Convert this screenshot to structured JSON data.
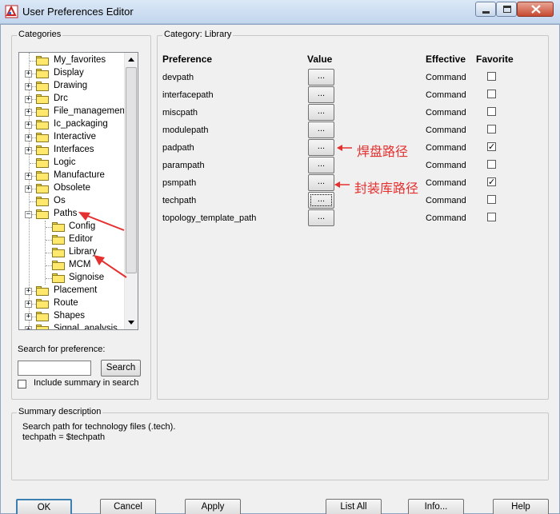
{
  "window": {
    "title": "User Preferences Editor"
  },
  "categories": {
    "label": "Categories",
    "items": [
      {
        "label": "My_favorites",
        "expander": ""
      },
      {
        "label": "Display",
        "expander": "+"
      },
      {
        "label": "Drawing",
        "expander": "+"
      },
      {
        "label": "Drc",
        "expander": "+"
      },
      {
        "label": "File_management",
        "expander": "+"
      },
      {
        "label": "Ic_packaging",
        "expander": "+"
      },
      {
        "label": "Interactive",
        "expander": "+"
      },
      {
        "label": "Interfaces",
        "expander": "+"
      },
      {
        "label": "Logic",
        "expander": ""
      },
      {
        "label": "Manufacture",
        "expander": "+"
      },
      {
        "label": "Obsolete",
        "expander": "+"
      },
      {
        "label": "Os",
        "expander": ""
      },
      {
        "label": "Paths",
        "expander": "−"
      },
      {
        "label": "Config",
        "expander": ""
      },
      {
        "label": "Editor",
        "expander": ""
      },
      {
        "label": "Library",
        "expander": ""
      },
      {
        "label": "MCM",
        "expander": ""
      },
      {
        "label": "Signoise",
        "expander": ""
      },
      {
        "label": "Placement",
        "expander": "+"
      },
      {
        "label": "Route",
        "expander": "+"
      },
      {
        "label": "Shapes",
        "expander": "+"
      },
      {
        "label": "Signal_analysis",
        "expander": "+"
      }
    ]
  },
  "search": {
    "label": "Search for preference:",
    "value": "",
    "button": "Search",
    "include_summary_label": "Include summary in search",
    "include_summary_checked": false
  },
  "category_panel": {
    "label": "Category:  Library",
    "headers": {
      "preference": "Preference",
      "value": "Value",
      "effective": "Effective",
      "favorite": "Favorite"
    },
    "value_button_label": "...",
    "rows": [
      {
        "name": "devpath",
        "effective": "Command",
        "favorite": false
      },
      {
        "name": "interfacepath",
        "effective": "Command",
        "favorite": false
      },
      {
        "name": "miscpath",
        "effective": "Command",
        "favorite": false
      },
      {
        "name": "modulepath",
        "effective": "Command",
        "favorite": false
      },
      {
        "name": "padpath",
        "effective": "Command",
        "favorite": true
      },
      {
        "name": "parampath",
        "effective": "Command",
        "favorite": false
      },
      {
        "name": "psmpath",
        "effective": "Command",
        "favorite": true
      },
      {
        "name": "techpath",
        "effective": "Command",
        "favorite": false
      },
      {
        "name": "topology_template_path",
        "effective": "Command",
        "favorite": false
      }
    ]
  },
  "annotations": {
    "padpath_note": "焊盘路径",
    "psmpath_note": "封装库路径",
    "color": "#e53030"
  },
  "summary": {
    "label": "Summary description",
    "line1": "Search path for technology files (.tech).",
    "line2": "techpath = $techpath"
  },
  "buttons": {
    "ok": "OK",
    "cancel": "Cancel",
    "apply": "Apply",
    "list_all": "List All",
    "info": "Info...",
    "help": "Help"
  }
}
